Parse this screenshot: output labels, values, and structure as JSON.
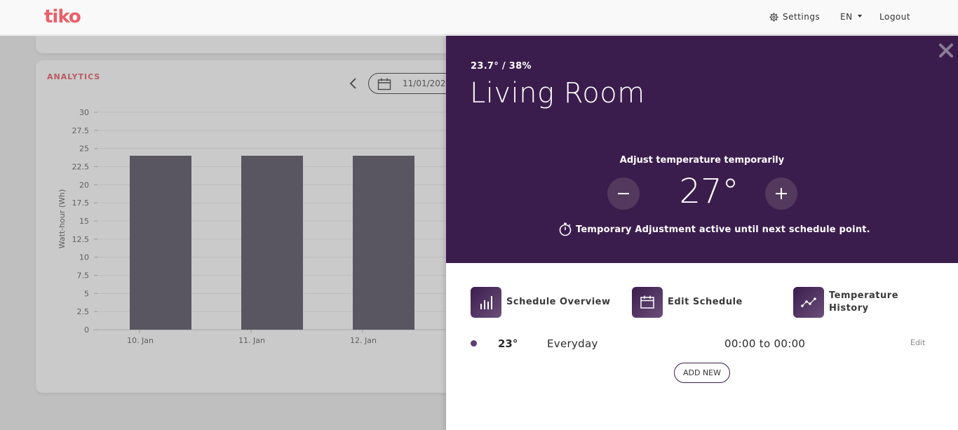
{
  "navbar": {
    "logo": "tiko",
    "settings_label": "Settings",
    "lang_label": "EN",
    "logout_label": "Logout"
  },
  "analytics": {
    "title": "ANALYTICS",
    "date_value": "11/01/202"
  },
  "chart_data": {
    "type": "bar",
    "categories": [
      "10. Jan",
      "11. Jan",
      "12. Jan"
    ],
    "values": [
      24,
      24,
      24
    ],
    "ylabel": "Watt-hour (Wh)",
    "xlabel": "",
    "ylim": [
      0,
      30
    ],
    "yticks": [
      "0",
      "2.5",
      "5",
      "7.5",
      "10",
      "12.5",
      "15",
      "17.5",
      "20",
      "22.5",
      "25",
      "27.5",
      "30"
    ],
    "bar_color": "#5e5a6a",
    "grid": true
  },
  "panel": {
    "temp_humidity": "23.7° / 38%",
    "room_name": "Living Room",
    "adjust_label": "Adjust temperature temporarily",
    "set_temp": "27°",
    "note": "Temporary Adjustment active until next schedule point.",
    "actions": [
      {
        "label": "Schedule Overview",
        "icon": "bar-chart-icon"
      },
      {
        "label": "Edit Schedule",
        "icon": "calendar-icon"
      },
      {
        "label": "Temperature History",
        "icon": "line-chart-icon"
      }
    ],
    "schedule": [
      {
        "temp": "23°",
        "days": "Everyday",
        "time": "00:00 to 00:00",
        "edit": "Edit"
      }
    ],
    "add_new_label": "ADD NEW"
  },
  "colors": {
    "brand": "#e8606a",
    "panel_header": "#3b1d4d",
    "accent": "#54395f"
  }
}
